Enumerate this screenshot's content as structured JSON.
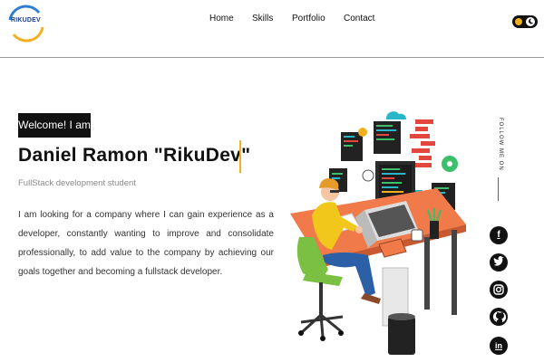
{
  "header": {
    "logo_text": "RIKUDEV",
    "nav": [
      "Home",
      "Skills",
      "Portfolio",
      "Contact"
    ]
  },
  "hero": {
    "welcome": "Welcome! I am",
    "name": "Daniel Ramon \"RikuDev\"",
    "subtitle": "FullStack development student",
    "intro": "I am looking for a company where I can gain experience as a developer, constantly wanting to improve and consolidate professionally, to add value to the company by achieving our goals together and becoming a fullstack developer."
  },
  "social": {
    "follow_label": "FOLLOW ME ON",
    "icons": [
      "facebook-icon",
      "twitter-icon",
      "instagram-icon",
      "github-icon",
      "linkedin-icon"
    ]
  },
  "colors": {
    "accent": "#f2b01e",
    "dark": "#111111",
    "logo_blue": "#1a3f8f"
  }
}
